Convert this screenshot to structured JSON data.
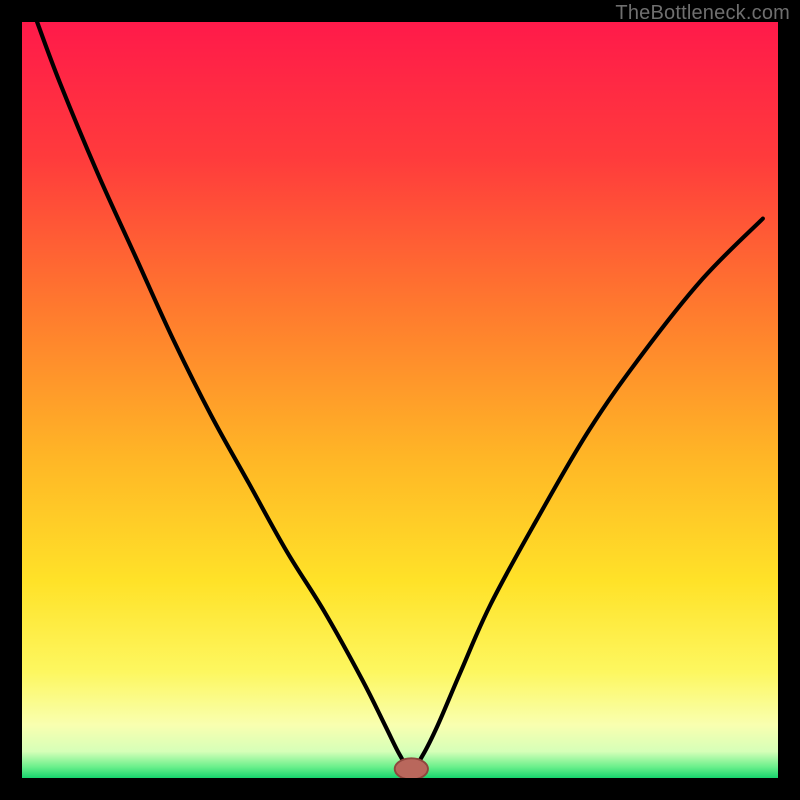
{
  "watermark": "TheBottleneck.com",
  "colors": {
    "frame": "#000000",
    "gradient_stops": [
      {
        "offset": 0.0,
        "color": "#ff1a4a"
      },
      {
        "offset": 0.18,
        "color": "#ff3b3c"
      },
      {
        "offset": 0.38,
        "color": "#ff7a2e"
      },
      {
        "offset": 0.58,
        "color": "#ffb726"
      },
      {
        "offset": 0.74,
        "color": "#ffe228"
      },
      {
        "offset": 0.86,
        "color": "#fdf760"
      },
      {
        "offset": 0.93,
        "color": "#f9ffb0"
      },
      {
        "offset": 0.965,
        "color": "#d6ffb8"
      },
      {
        "offset": 0.985,
        "color": "#6cf08c"
      },
      {
        "offset": 1.0,
        "color": "#17d36d"
      }
    ],
    "curve": "#000000",
    "marker_fill": "#b9675c",
    "marker_stroke": "#8e463d"
  },
  "chart_data": {
    "type": "line",
    "title": "",
    "xlabel": "",
    "ylabel": "",
    "xlim": [
      0,
      100
    ],
    "ylim": [
      0,
      100
    ],
    "series": [
      {
        "name": "bottleneck-curve",
        "x": [
          2,
          5,
          10,
          15,
          20,
          25,
          30,
          35,
          40,
          45,
          48,
          50,
          51.5,
          53,
          55,
          58,
          62,
          68,
          75,
          82,
          90,
          98
        ],
        "y": [
          100,
          92,
          80,
          69,
          58,
          48,
          39,
          30,
          22,
          13,
          7,
          3,
          1,
          3,
          7,
          14,
          23,
          34,
          46,
          56,
          66,
          74
        ]
      }
    ],
    "marker": {
      "x": 51.5,
      "y": 1.2,
      "rx": 2.2,
      "ry": 1.4
    },
    "grid": false,
    "legend": false
  }
}
